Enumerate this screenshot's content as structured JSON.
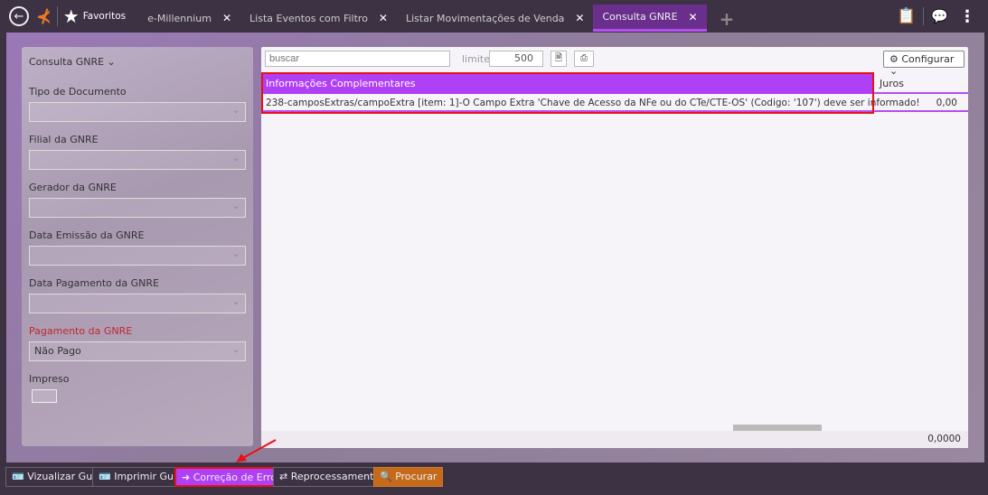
{
  "topbar": {
    "favorites": "Favoritos",
    "tabs": [
      {
        "label": "e-Millennium"
      },
      {
        "label": "Lista Eventos com Filtro"
      },
      {
        "label": "Listar Movimentações de Venda"
      },
      {
        "label": "Consulta GNRE",
        "active": true
      }
    ]
  },
  "filters": {
    "title": "Consulta GNRE",
    "fields": [
      {
        "label": "Tipo de Documento",
        "value": ""
      },
      {
        "label": "Filial da GNRE",
        "value": ""
      },
      {
        "label": "Gerador da GNRE",
        "value": ""
      },
      {
        "label": "Data Emissão da GNRE",
        "value": ""
      },
      {
        "label": "Data Pagamento da GNRE",
        "value": ""
      },
      {
        "label": "Pagamento da GNRE",
        "value": "Não Pago",
        "required": true
      }
    ],
    "impreso_label": "Impreso"
  },
  "grid": {
    "search_placeholder": "buscar",
    "limit_label": "limite:",
    "limit_value": "500",
    "configure_label": "Configurar",
    "columns": [
      "Informações Complementares",
      "Juros"
    ],
    "rows": [
      {
        "info": "238-camposExtras/campoExtra [item: 1]-O Campo Extra 'Chave de Acesso da NFe ou do CTe/CTE-OS' (Codigo: '107') deve ser informado!",
        "juros": "0,00"
      }
    ],
    "total": "0,0000"
  },
  "actions": {
    "view": "Vizualizar Guia",
    "print": "Imprimir Guia",
    "fix": "Correção de Erros",
    "reprocess": "Reprocessamento",
    "search": "Procurar"
  },
  "colors": {
    "accent": "#b040f5",
    "highlight": "#e8101a",
    "search_button": "#c46a1a"
  }
}
